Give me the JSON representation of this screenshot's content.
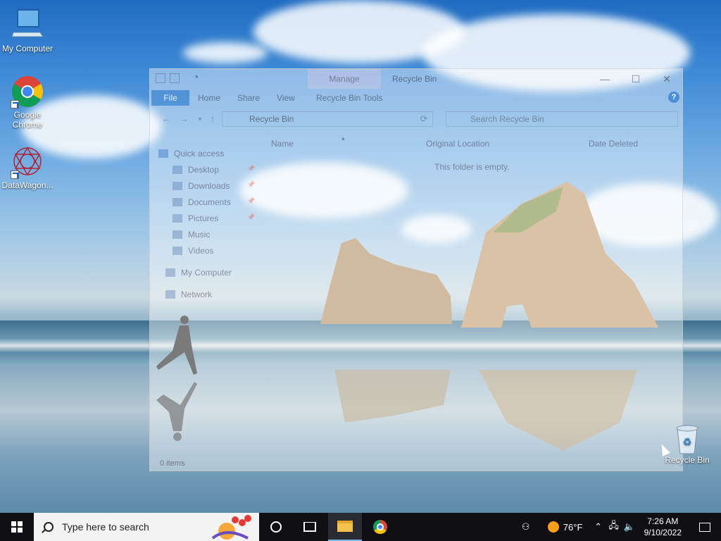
{
  "desktop": {
    "icons": [
      {
        "label": "My Computer"
      },
      {
        "label": "Google Chrome"
      },
      {
        "label": "DataWagon..."
      }
    ],
    "recycle_bin_label": "Recycle Bin"
  },
  "explorer": {
    "manage_tab": "Manage",
    "title": "Recycle Bin",
    "ribbon_tabs": [
      "File",
      "Home",
      "Share",
      "View",
      "Recycle Bin Tools"
    ],
    "address": "Recycle Bin",
    "search_placeholder": "Search Recycle Bin",
    "nav": {
      "quick_access": "Quick access",
      "items": [
        "Desktop",
        "Downloads",
        "Documents",
        "Pictures",
        "Music",
        "Videos"
      ],
      "my_computer": "My Computer",
      "network": "Network"
    },
    "columns": [
      "Name",
      "Original Location",
      "Date Deleted"
    ],
    "empty_message": "This folder is empty.",
    "status": "0 items"
  },
  "taskbar": {
    "search_placeholder": "Type here to search",
    "weather_temp": "76°F",
    "time": "7:26 AM",
    "date": "9/10/2022"
  }
}
